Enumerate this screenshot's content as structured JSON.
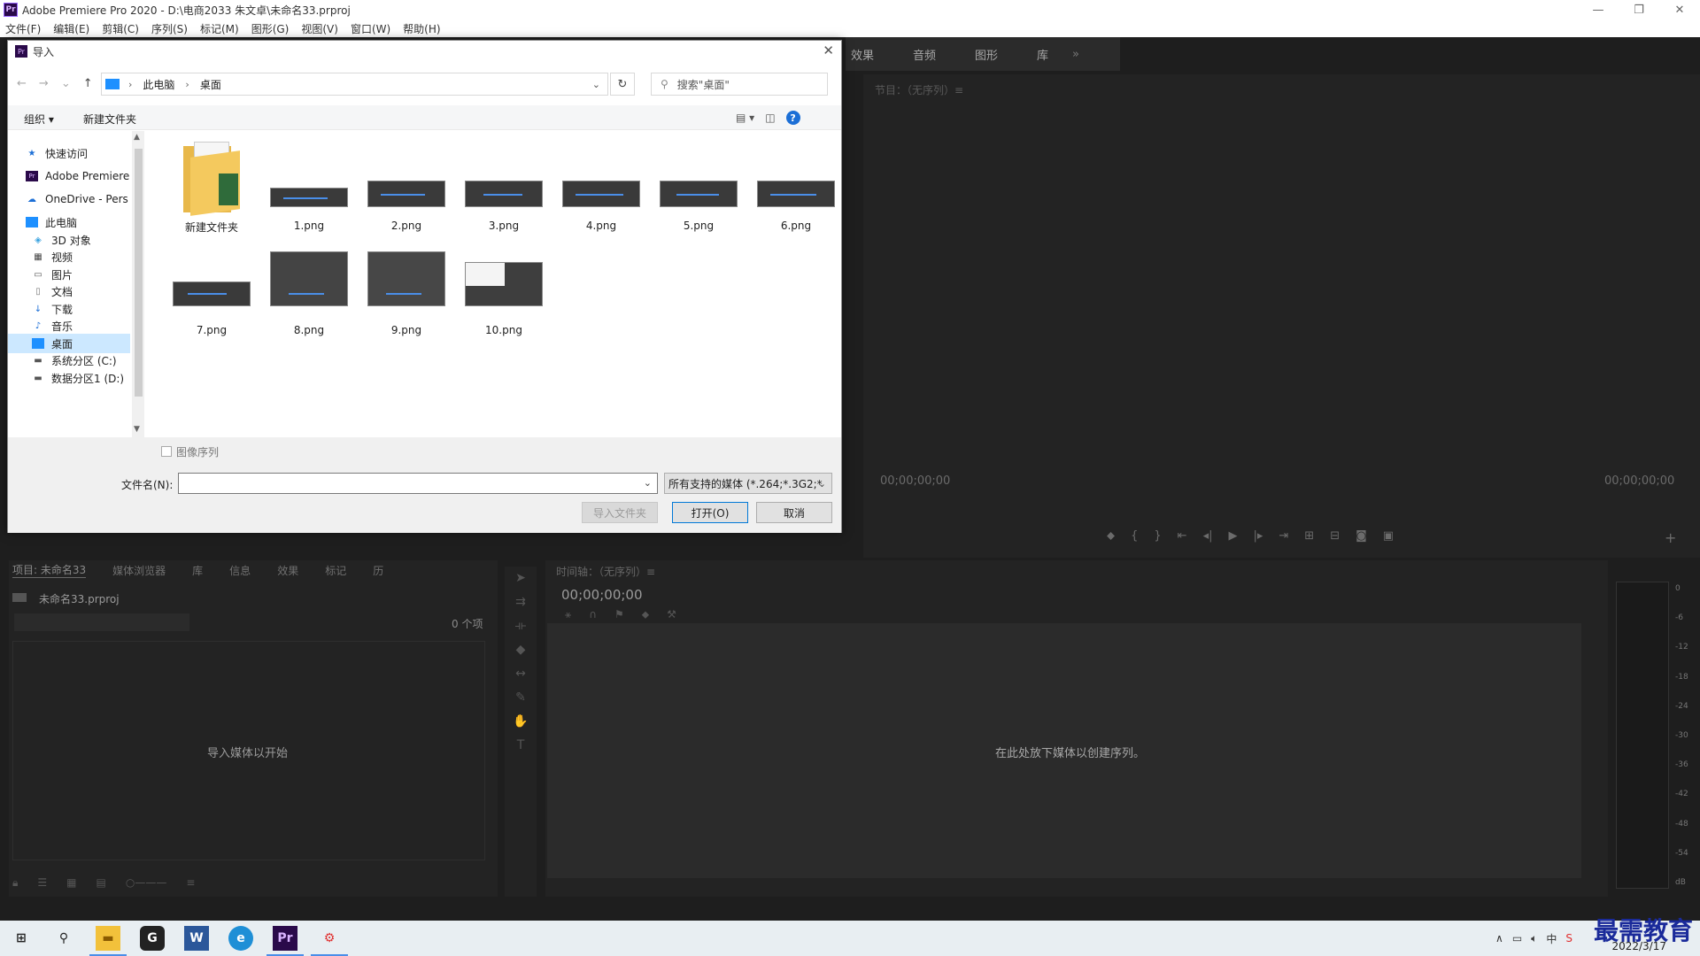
{
  "window": {
    "title": "Adobe Premiere Pro 2020 - D:\\电商2033 朱文卓\\未命名33.prproj",
    "app_icon": "Pr"
  },
  "menu": [
    "文件(F)",
    "编辑(E)",
    "剪辑(C)",
    "序列(S)",
    "标记(M)",
    "图形(G)",
    "视图(V)",
    "窗口(W)",
    "帮助(H)"
  ],
  "top_tabs": [
    "效果",
    "音频",
    "图形",
    "库"
  ],
  "program_monitor": {
    "title": "节目：（无序列）≡",
    "tc_left": "00;00;00;00",
    "tc_right": "00;00;00;00"
  },
  "project_panel": {
    "tabs": [
      "项目: 未命名33",
      "媒体浏览器",
      "库",
      "信息",
      "效果",
      "标记",
      "历"
    ],
    "file": "未命名33.prproj",
    "count": "0 个项",
    "drop_text": "导入媒体以开始"
  },
  "timeline": {
    "title": "时间轴：（无序列）≡",
    "timecode": "00;00;00;00",
    "drop_text": "在此处放下媒体以创建序列。"
  },
  "audio_meter": {
    "labels": [
      "0",
      "-6",
      "-12",
      "-18",
      "-24",
      "-30",
      "-36",
      "-42",
      "-48",
      "-54",
      "dB"
    ]
  },
  "dialog": {
    "title": "导入",
    "address": [
      "此电脑",
      "桌面"
    ],
    "search_placeholder": "搜索\"桌面\"",
    "commands": {
      "organize": "组织 ▾",
      "new_folder": "新建文件夹"
    },
    "nav": [
      {
        "label": "快速访问",
        "icon": "star-icon",
        "indent": 0
      },
      {
        "label": "Adobe Premiere",
        "icon": "premiere-icon",
        "indent": 0
      },
      {
        "label": "OneDrive - Pers",
        "icon": "cloud-icon",
        "indent": 0
      },
      {
        "label": "此电脑",
        "icon": "computer-icon",
        "indent": 0
      },
      {
        "label": "3D 对象",
        "icon": "cube-icon",
        "indent": 1
      },
      {
        "label": "视频",
        "icon": "video-icon",
        "indent": 1
      },
      {
        "label": "图片",
        "icon": "picture-icon",
        "indent": 1
      },
      {
        "label": "文档",
        "icon": "document-icon",
        "indent": 1
      },
      {
        "label": "下载",
        "icon": "download-icon",
        "indent": 1
      },
      {
        "label": "音乐",
        "icon": "music-icon",
        "indent": 1
      },
      {
        "label": "桌面",
        "icon": "desktop-icon",
        "indent": 1,
        "selected": true
      },
      {
        "label": "系统分区 (C:)",
        "icon": "drive-icon",
        "indent": 1
      },
      {
        "label": "数据分区1 (D:)",
        "icon": "drive-icon",
        "indent": 1
      }
    ],
    "files": [
      "新建文件夹",
      "1.png",
      "2.png",
      "3.png",
      "4.png",
      "5.png",
      "6.png",
      "7.png",
      "8.png",
      "9.png",
      "10.png"
    ],
    "image_sequence_label": "图像序列",
    "filename_label": "文件名(N):",
    "filename_value": "",
    "filetype_value": "所有支持的媒体 (*.264;*.3G2;*",
    "buttons": {
      "import_folder": "导入文件夹",
      "open": "打开(O)",
      "cancel": "取消"
    }
  },
  "taskbar": {
    "date": "2022/3/17",
    "watermark": "最需教育"
  },
  "colors": {
    "accent": "#0078d7",
    "panel_bg": "#232323",
    "selection": "#cce8ff"
  }
}
